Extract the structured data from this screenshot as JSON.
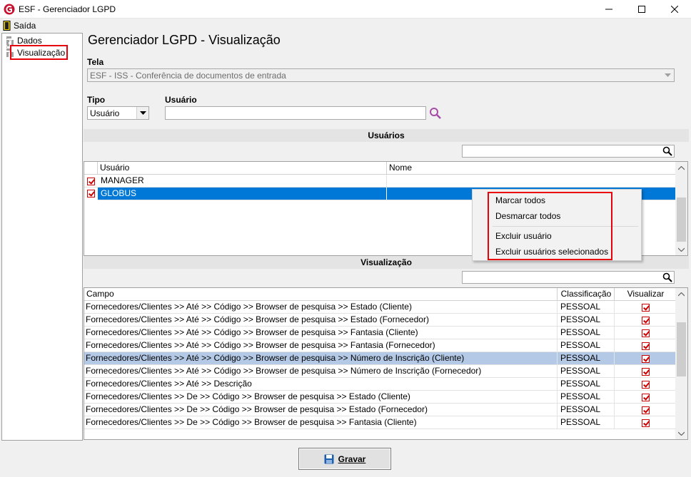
{
  "window": {
    "title": "ESF - Gerenciador LGPD"
  },
  "menubar": {
    "exit_label": "Saída"
  },
  "tree": {
    "items": [
      {
        "label": "Dados"
      },
      {
        "label": "Visualização"
      }
    ]
  },
  "page": {
    "title": "Gerenciador LGPD - Visualização"
  },
  "tela": {
    "label": "Tela",
    "value": "ESF - ISS - Conferência de documentos de entrada"
  },
  "tipo": {
    "label": "Tipo",
    "value": "Usuário"
  },
  "usuario_filter": {
    "label": "Usuário",
    "value": ""
  },
  "users_section": {
    "title": "Usuários",
    "columns": [
      "Usuário",
      "Nome"
    ],
    "rows": [
      {
        "usuario": "MANAGER",
        "nome": "",
        "checked": true
      },
      {
        "usuario": "GLOBUS",
        "nome": "",
        "checked": true
      }
    ]
  },
  "context_menu": {
    "items": [
      "Marcar todos",
      "Desmarcar todos",
      "Excluir usuário",
      "Excluir usuários selecionados"
    ]
  },
  "view_section": {
    "title": "Visualização",
    "columns": [
      "Campo",
      "Classificação",
      "Visualizar"
    ],
    "rows": [
      {
        "campo": "Fornecedores/Clientes >> Até >> Código >> Browser de pesquisa >> Estado (Cliente)",
        "classificacao": "PESSOAL",
        "visualizar": true
      },
      {
        "campo": "Fornecedores/Clientes >> Até >> Código >> Browser de pesquisa >> Estado (Fornecedor)",
        "classificacao": "PESSOAL",
        "visualizar": true
      },
      {
        "campo": "Fornecedores/Clientes >> Até >> Código >> Browser de pesquisa >> Fantasia (Cliente)",
        "classificacao": "PESSOAL",
        "visualizar": true
      },
      {
        "campo": "Fornecedores/Clientes >> Até >> Código >> Browser de pesquisa >> Fantasia (Fornecedor)",
        "classificacao": "PESSOAL",
        "visualizar": true
      },
      {
        "campo": "Fornecedores/Clientes >> Até >> Código >> Browser de pesquisa >> Número de Inscrição (Cliente)",
        "classificacao": "PESSOAL",
        "visualizar": true
      },
      {
        "campo": "Fornecedores/Clientes >> Até >> Código >> Browser de pesquisa >> Número de Inscrição (Fornecedor)",
        "classificacao": "PESSOAL",
        "visualizar": true
      },
      {
        "campo": "Fornecedores/Clientes >> Até >> Descrição",
        "classificacao": "PESSOAL",
        "visualizar": true
      },
      {
        "campo": "Fornecedores/Clientes >> De >> Código >> Browser de pesquisa >> Estado (Cliente)",
        "classificacao": "PESSOAL",
        "visualizar": true
      },
      {
        "campo": "Fornecedores/Clientes >> De >> Código >> Browser de pesquisa >> Estado (Fornecedor)",
        "classificacao": "PESSOAL",
        "visualizar": true
      },
      {
        "campo": "Fornecedores/Clientes >> De >> Código >> Browser de pesquisa >> Fantasia (Cliente)",
        "classificacao": "PESSOAL",
        "visualizar": true
      }
    ]
  },
  "footer": {
    "save_label": "Gravar"
  },
  "colors": {
    "highlight_red": "#e8000b",
    "selection_blue": "#0078d7",
    "row_select": "#b3c9e6"
  }
}
